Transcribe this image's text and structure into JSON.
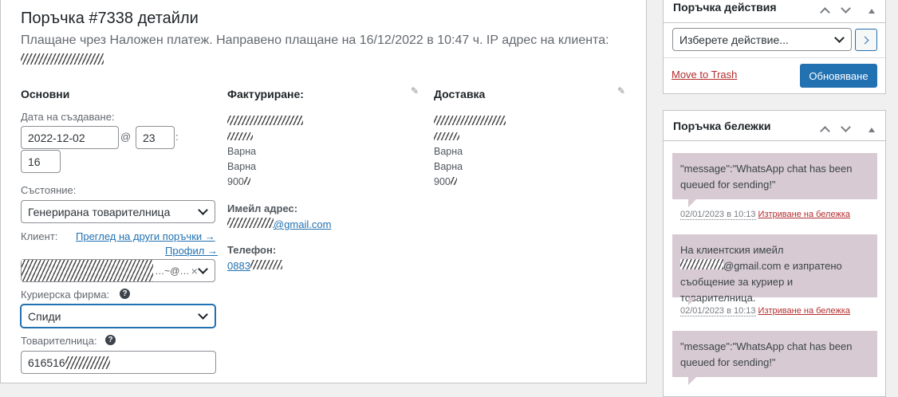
{
  "order": {
    "title": "Поръчка #7338 детайли",
    "subtitle": "Плащане чрез Наложен платеж. Направено плащане на 16/12/2022 в 10:47 ч. IP адрес на клиента:"
  },
  "general": {
    "heading": "Основни",
    "created_label": "Дата на създаване:",
    "date_value": "2022-12-02",
    "at_sign": "@",
    "hour_value": "23",
    "colon": ":",
    "minute_value": "16",
    "status_label": "Състояние:",
    "status_value": "Генерирана товарителница",
    "customer_label": "Клиент:",
    "other_orders_link": "Преглед на други поръчки →",
    "profile_link": "Профил →",
    "customer_value_suffix": "…~@…",
    "clear_symbol": "×",
    "courier_label": "Куриерска фирма:",
    "courier_value": "Спиди",
    "waybill_label": "Товарителница:",
    "waybill_value": "616516",
    "help_symbol": "?"
  },
  "billing": {
    "heading": "Фактуриране:",
    "city1": "Варна",
    "city2": "Варна",
    "zip": "900",
    "email_label": "Имейл адрес:",
    "email_value": "@gmail.com",
    "phone_label": "Телефон:",
    "phone_value": "0883"
  },
  "shipping": {
    "heading": "Доставка",
    "city1": "Варна",
    "city2": "Варна",
    "zip": "900"
  },
  "actions_box": {
    "title": "Поръчка действия",
    "select_placeholder": "Изберете действие...",
    "trash_link": "Move to Trash",
    "update_button": "Обновяване"
  },
  "notes_box": {
    "title": "Поръчка бележки",
    "notes": [
      {
        "text": "\"message\":\"WhatsApp chat has been queued for sending!\"",
        "date": "02/01/2023 в 10:13",
        "delete": "Изтриване на бележка"
      },
      {
        "text_line1": "На клиентския имейл",
        "text_email": "@gmail.com е изпратено",
        "text_line3": "съобщение за куриер и товарителница.",
        "date": "02/01/2023 в 10:13",
        "delete": "Изтриване на бележка"
      },
      {
        "text": "\"message\":\"WhatsApp chat has been queued for sending!\""
      }
    ]
  },
  "colors": {
    "accent": "#2271b1",
    "delete_red": "#b32d2e",
    "note_bg": "#d7cad2"
  }
}
